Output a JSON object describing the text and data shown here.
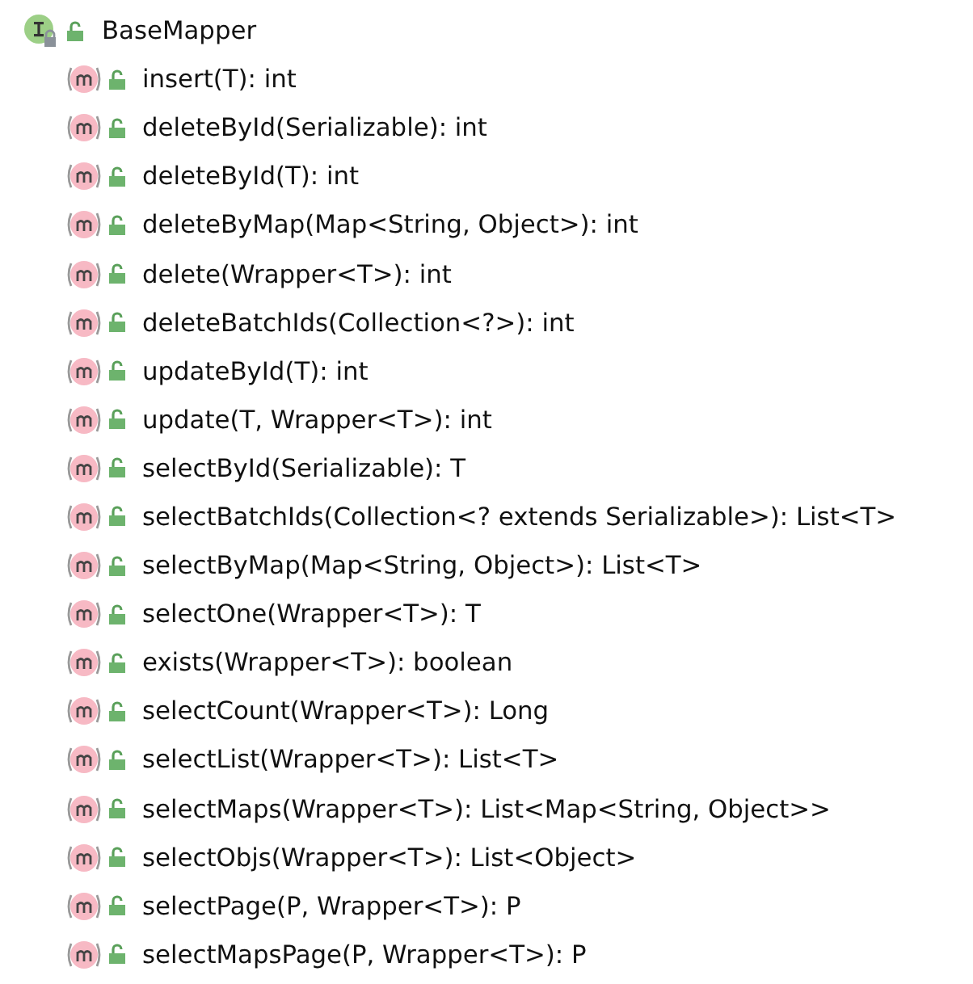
{
  "tree": {
    "label": "BaseMapper",
    "kind": "interface",
    "expanded": true,
    "children": [
      {
        "label": "insert(T): int",
        "kind": "method"
      },
      {
        "label": "deleteById(Serializable): int",
        "kind": "method"
      },
      {
        "label": "deleteById(T): int",
        "kind": "method"
      },
      {
        "label": "deleteByMap(Map<String, Object>): int",
        "kind": "method"
      },
      {
        "label": "delete(Wrapper<T>): int",
        "kind": "method"
      },
      {
        "label": "deleteBatchIds(Collection<?>): int",
        "kind": "method"
      },
      {
        "label": "updateById(T): int",
        "kind": "method"
      },
      {
        "label": "update(T, Wrapper<T>): int",
        "kind": "method"
      },
      {
        "label": "selectById(Serializable): T",
        "kind": "method"
      },
      {
        "label": "selectBatchIds(Collection<? extends Serializable>): List<T>",
        "kind": "method"
      },
      {
        "label": "selectByMap(Map<String, Object>): List<T>",
        "kind": "method"
      },
      {
        "label": "selectOne(Wrapper<T>): T",
        "kind": "method"
      },
      {
        "label": "exists(Wrapper<T>): boolean",
        "kind": "method"
      },
      {
        "label": "selectCount(Wrapper<T>): Long",
        "kind": "method"
      },
      {
        "label": "selectList(Wrapper<T>): List<T>",
        "kind": "method"
      },
      {
        "label": "selectMaps(Wrapper<T>): List<Map<String, Object>>",
        "kind": "method"
      },
      {
        "label": "selectObjs(Wrapper<T>): List<Object>",
        "kind": "method"
      },
      {
        "label": "selectPage(P, Wrapper<T>): P",
        "kind": "method"
      },
      {
        "label": "selectMapsPage(P, Wrapper<T>): P",
        "kind": "method"
      }
    ]
  }
}
